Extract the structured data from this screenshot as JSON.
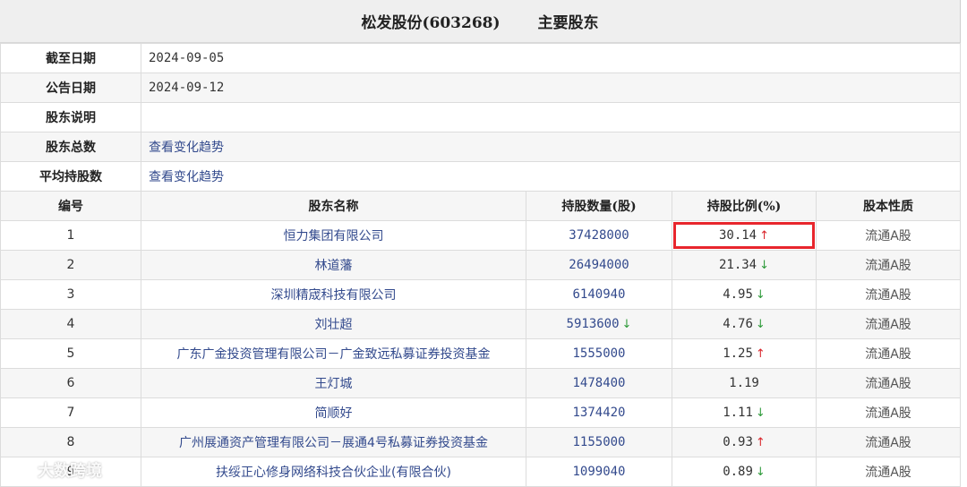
{
  "header": {
    "company": "松发股份(603268)",
    "section": "主要股东"
  },
  "info": [
    {
      "label": "截至日期",
      "value": "2024-09-05",
      "link": false
    },
    {
      "label": "公告日期",
      "value": "2024-09-12",
      "link": false
    },
    {
      "label": "股东说明",
      "value": "",
      "link": false
    },
    {
      "label": "股东总数",
      "value": "查看变化趋势",
      "link": true
    },
    {
      "label": "平均持股数",
      "value": "查看变化趋势",
      "link": true
    }
  ],
  "columns": [
    "编号",
    "股东名称",
    "持股数量(股)",
    "持股比例(%)",
    "股本性质"
  ],
  "rows": [
    {
      "no": "1",
      "name": "恒力集团有限公司",
      "shares": "37428000",
      "shares_trend": "",
      "ratio": "30.14",
      "ratio_trend": "up",
      "nature": "流通A股"
    },
    {
      "no": "2",
      "name": "林道藩",
      "shares": "26494000",
      "shares_trend": "",
      "ratio": "21.34",
      "ratio_trend": "down",
      "nature": "流通A股"
    },
    {
      "no": "3",
      "name": "深圳精宬科技有限公司",
      "shares": "6140940",
      "shares_trend": "",
      "ratio": "4.95",
      "ratio_trend": "down",
      "nature": "流通A股"
    },
    {
      "no": "4",
      "name": "刘壮超",
      "shares": "5913600",
      "shares_trend": "down",
      "ratio": "4.76",
      "ratio_trend": "down",
      "nature": "流通A股"
    },
    {
      "no": "5",
      "name": "广东广金投资管理有限公司－广金致远私募证券投资基金",
      "shares": "1555000",
      "shares_trend": "",
      "ratio": "1.25",
      "ratio_trend": "up",
      "nature": "流通A股"
    },
    {
      "no": "6",
      "name": "王灯城",
      "shares": "1478400",
      "shares_trend": "",
      "ratio": "1.19",
      "ratio_trend": "",
      "nature": "流通A股"
    },
    {
      "no": "7",
      "name": "简顺好",
      "shares": "1374420",
      "shares_trend": "",
      "ratio": "1.11",
      "ratio_trend": "down",
      "nature": "流通A股"
    },
    {
      "no": "8",
      "name": "广州展通资产管理有限公司－展通4号私募证券投资基金",
      "shares": "1155000",
      "shares_trend": "",
      "ratio": "0.93",
      "ratio_trend": "up",
      "nature": "流通A股"
    },
    {
      "no": "9",
      "name": "扶绥正心修身网络科技合伙企业(有限合伙)",
      "shares": "1099040",
      "shares_trend": "",
      "ratio": "0.89",
      "ratio_trend": "down",
      "nature": "流通A股"
    }
  ],
  "highlight": {
    "row": 0,
    "column": "ratio",
    "color": "#e8262d"
  },
  "trend_colors": {
    "up": "#d9252b",
    "down": "#2e9a3a"
  },
  "watermark": {
    "text": "大数跨境"
  }
}
